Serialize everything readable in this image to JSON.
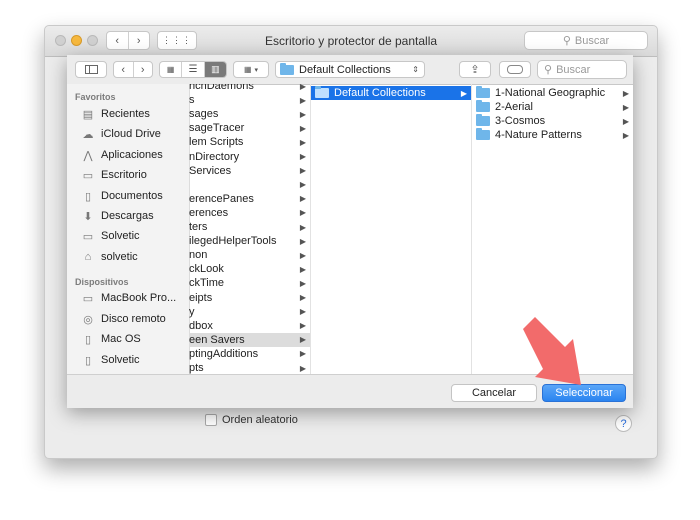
{
  "window": {
    "title": "Escritorio y protector de pantalla",
    "search_placeholder": "Buscar",
    "random_order_label": "Orden aleatorio",
    "help_label": "?"
  },
  "dialog": {
    "path_popup": "Default Collections",
    "search_placeholder": "Buscar",
    "sidebar": {
      "favorites_header": "Favoritos",
      "favorites": [
        {
          "label": "Recientes",
          "icon": "clock-icon"
        },
        {
          "label": "iCloud Drive",
          "icon": "cloud-icon"
        },
        {
          "label": "Aplicaciones",
          "icon": "applications-icon"
        },
        {
          "label": "Escritorio",
          "icon": "desktop-icon"
        },
        {
          "label": "Documentos",
          "icon": "document-icon"
        },
        {
          "label": "Descargas",
          "icon": "download-icon"
        },
        {
          "label": "Solvetic",
          "icon": "folder-icon"
        },
        {
          "label": "solvetic",
          "icon": "home-icon"
        }
      ],
      "devices_header": "Dispositivos",
      "devices": [
        {
          "label": "MacBook Pro...",
          "icon": "laptop-icon"
        },
        {
          "label": "Disco remoto",
          "icon": "disc-icon"
        },
        {
          "label": "Mac OS",
          "icon": "drive-icon"
        },
        {
          "label": "Solvetic",
          "icon": "drive-icon"
        }
      ]
    },
    "column1": [
      "nchDaemons",
      "s",
      "sages",
      "sageTracer",
      "lem Scripts",
      "nDirectory",
      " Services",
      "",
      "erencePanes",
      "erences",
      "ters",
      "ilegedHelperTools",
      "non",
      "ckLook",
      "ckTime",
      "eipts",
      "y",
      "dbox",
      "een Savers",
      "ptingAdditions",
      "pts"
    ],
    "column1_selected": "een Savers",
    "column2": [
      "Default Collections"
    ],
    "column3": [
      "1-National Geographic",
      "2-Aerial",
      "3-Cosmos",
      "4-Nature Patterns"
    ],
    "cancel_label": "Cancelar",
    "select_label": "Seleccionar"
  },
  "colors": {
    "selection": "#1a73e8",
    "inactive_selection": "#dcdcdc",
    "arrow": "#f26b6b",
    "primary_button": "#2a84f0"
  }
}
